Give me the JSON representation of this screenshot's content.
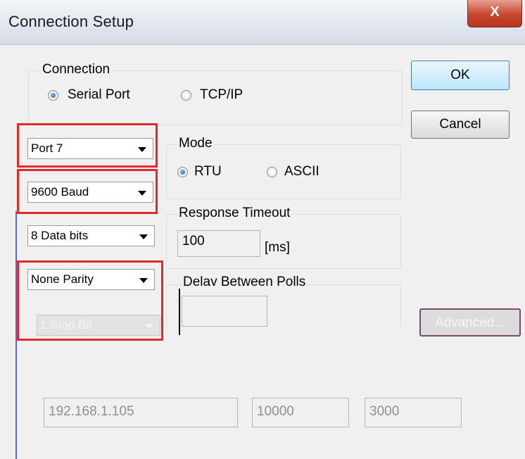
{
  "window": {
    "title": "Connection Setup",
    "close_glyph": "X"
  },
  "connection": {
    "legend": "Connection",
    "options": [
      {
        "label": "Serial Port",
        "selected": true
      },
      {
        "label": "TCP/IP",
        "selected": false
      }
    ]
  },
  "buttons": {
    "ok": "OK",
    "cancel": "Cancel",
    "advanced": "Advanced..."
  },
  "serial": {
    "port": "Port 7",
    "baud": "9600 Baud",
    "data_bits": "8 Data bits",
    "parity": "None Parity",
    "stop_bits": "1 Stop Bit"
  },
  "mode": {
    "legend": "Mode",
    "options": [
      {
        "label": "RTU",
        "selected": true
      },
      {
        "label": "ASCII",
        "selected": false
      }
    ]
  },
  "response_timeout": {
    "legend": "Response Timeout",
    "value": "100",
    "unit": "[ms]"
  },
  "delay_between_polls": {
    "legend": "Delay Between Polls",
    "value": ""
  },
  "tcp": {
    "ip": "192.168.1.105",
    "port": "10000",
    "timeout": "3000"
  },
  "colors": {
    "highlight": "#e32a2a",
    "accent": "#3c7fb1"
  }
}
